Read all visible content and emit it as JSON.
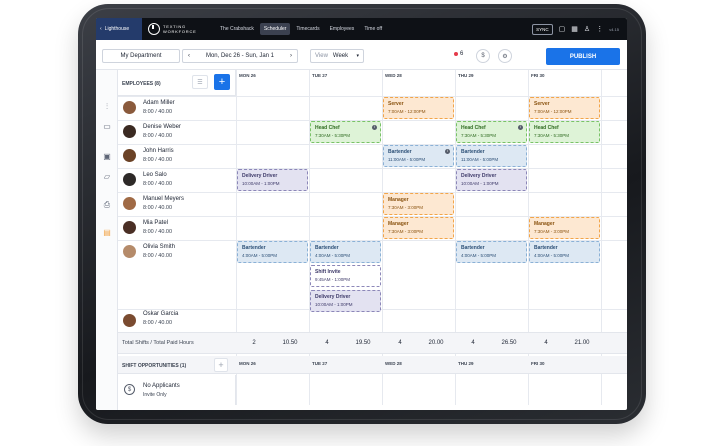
{
  "topbar": {
    "location": "Lighthouse",
    "logo_line1": "TEXTING",
    "logo_line2": "WORKFORCE",
    "nav": [
      {
        "label": "The Crabshack",
        "active": false
      },
      {
        "label": "Scheduler",
        "active": true
      },
      {
        "label": "Timecards",
        "active": false
      },
      {
        "label": "Employees",
        "active": false
      },
      {
        "label": "Time off",
        "active": false
      }
    ],
    "sync_label": "SYNC",
    "version": "v4.15"
  },
  "toolbar": {
    "department": "My Department",
    "prev": "‹",
    "date_range": "Mon, Dec 26 - Sun, Jan 1",
    "next": "›",
    "view_label": "View",
    "view_value": "Week",
    "alert_count": "6",
    "publish_label": "PUBLISH"
  },
  "schedule": {
    "employees_header": "EMPLOYEES (8)",
    "days": [
      "MON 26",
      "TUE 27",
      "WED 28",
      "THU 29",
      "FRI 30"
    ],
    "employees": [
      {
        "name": "Adam Miller",
        "hours": "8:00 / 40.00"
      },
      {
        "name": "Denise Weber",
        "hours": "8:00 / 40.00"
      },
      {
        "name": "John Harris",
        "hours": "8:00 / 40.00"
      },
      {
        "name": "Leo Salo",
        "hours": "8:00 / 40.00"
      },
      {
        "name": "Manuel Meyers",
        "hours": "8:00 / 40.00"
      },
      {
        "name": "Mia Patel",
        "hours": "8:00 / 40.00"
      },
      {
        "name": "Olivia Smith",
        "hours": "8:00 / 40.00"
      },
      {
        "name": "Oskar Garcia",
        "hours": "8:00 / 40.00"
      }
    ],
    "shifts": [
      {
        "role": "Server",
        "time": "7:00AM - 12:00PM"
      },
      {
        "role": "Server",
        "time": "7:00AM - 12:00PM"
      },
      {
        "role": "Head Chef",
        "time": "7:30AM - 5:30PM"
      },
      {
        "role": "Head Chef",
        "time": "7:30AM - 5:30PM"
      },
      {
        "role": "Head Chef",
        "time": "7:30AM - 5:30PM"
      },
      {
        "role": "Bartender",
        "time": "11:00AM - 5:00PM"
      },
      {
        "role": "Bartender",
        "time": "11:00AM - 5:00PM"
      },
      {
        "role": "Delivery Driver",
        "time": "10:00AM - 1:00PM"
      },
      {
        "role": "Delivery Driver",
        "time": "10:00AM - 1:00PM"
      },
      {
        "role": "Manager",
        "time": "7:30AM - 3:00PM"
      },
      {
        "role": "Manager",
        "time": "7:30AM - 3:00PM"
      },
      {
        "role": "Manager",
        "time": "7:30AM - 3:00PM"
      },
      {
        "role": "Bartender",
        "time": "4:00AM - 5:00PM"
      },
      {
        "role": "Bartender",
        "time": "4:00AM - 5:00PM"
      },
      {
        "role": "Bartender",
        "time": "4:00AM - 5:00PM"
      },
      {
        "role": "Bartender",
        "time": "4:00AM - 5:00PM"
      },
      {
        "role": "Shift Invite",
        "time": "9:45AM - 1:00PM"
      },
      {
        "role": "Delivery Driver",
        "time": "10:00AM - 1:00PM"
      }
    ],
    "totals_label": "Total Shifts / Total Paid Hours",
    "totals": [
      "2",
      "10.50",
      "4",
      "19.50",
      "4",
      "20.00",
      "4",
      "26.50",
      "4",
      "21.00"
    ],
    "opportunities_header": "SHIFT OPPORTUNITIES (1)",
    "opportunity": {
      "title": "No Applicants",
      "subtitle": "Invite Only",
      "icon": "dollar-icon"
    }
  },
  "colors": {
    "accent": "#1a73e8",
    "topbar": "#0e1116",
    "location": "#243b6b"
  }
}
